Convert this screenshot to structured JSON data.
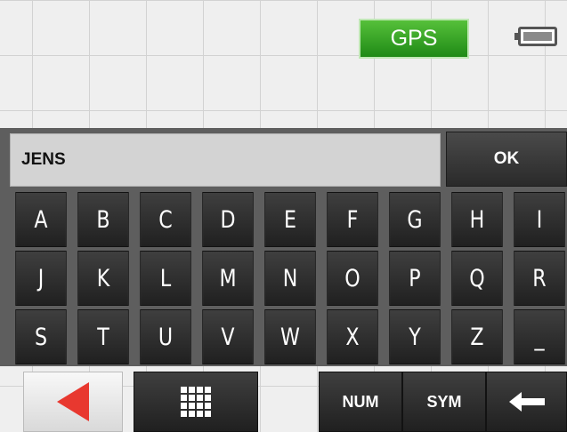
{
  "status": {
    "gps_label": "GPS"
  },
  "input": {
    "value": "JENS"
  },
  "ok_label": "OK",
  "keys": [
    "A",
    "B",
    "C",
    "D",
    "E",
    "F",
    "G",
    "H",
    "I",
    "J",
    "K",
    "L",
    "M",
    "N",
    "O",
    "P",
    "Q",
    "R",
    "S",
    "T",
    "U",
    "V",
    "W",
    "X",
    "Y",
    "Z",
    "_"
  ],
  "bottom": {
    "num_label": "NUM",
    "sym_label": "SYM"
  },
  "icons": {
    "back": "left-triangle",
    "grid": "keypad-grid",
    "backspace": "left-arrow",
    "battery": "battery"
  },
  "colors": {
    "gps_green": "#2f9d22",
    "back_arrow_red": "#e8382f"
  }
}
